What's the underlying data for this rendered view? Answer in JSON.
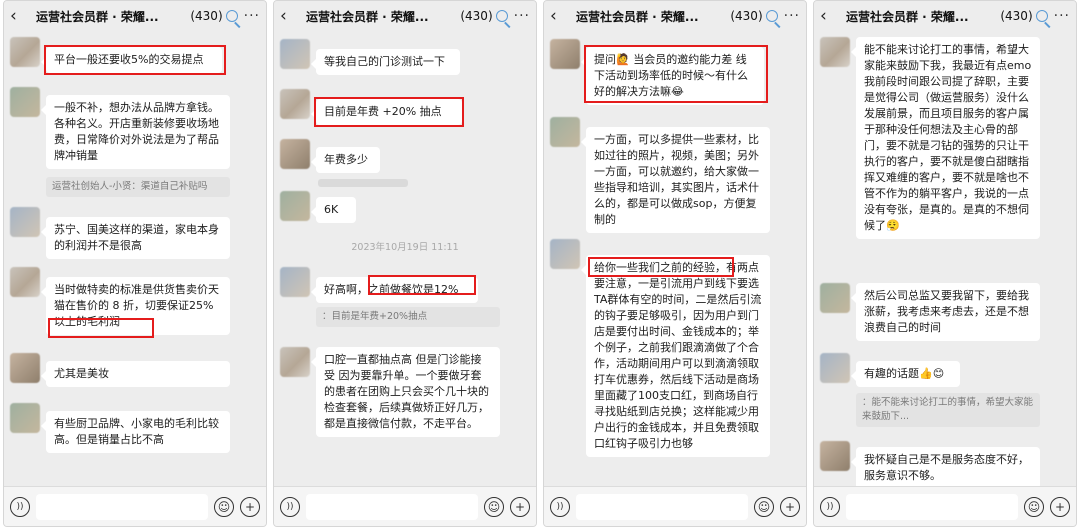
{
  "chat_header": {
    "back_icon": "chevron-left-icon",
    "title": "运营社会员群 · 荣耀...",
    "count": "(430)",
    "more": "···"
  },
  "panels": [
    {
      "messages": [
        "平台一般还要收5%的交易提点",
        "一般不补，想办法从品牌方拿钱。各种名义。开店重新装修要收场地费，日常降价对外说法是为了帮品牌冲销量",
        "苏宁、国美这样的渠道，家电本身的利润并不是很高",
        "当时做特卖的标准是供货售卖价天猫在售价的 8 折，切要保证25%以上的毛利润",
        "尤其是美妆",
        "有些厨卫品牌、小家电的毛利比较高。但是销量占比不高"
      ],
      "quote": "运营社创始人-小贤：渠道自己补贴吗"
    },
    {
      "messages": [
        "等我自己的门诊测试一下",
        "目前是年费 +20% 抽点",
        "年费多少",
        "6K",
        "好高啊，之前做餐饮是12%",
        "口腔一直都抽点高 但是门诊能接受 因为要靠升单。一个要做牙套的患者在团购上只会买个几十块的检查套餐，后续真做矫正好几万，都是直接微信付款，不走平台。"
      ],
      "timestamp": "2023年10月19日 11:11",
      "quote": "：目前是年费+20%抽点"
    },
    {
      "messages": [
        "提问🙋 当会员的邀约能力差 线下活动到场率低的时候～有什么好的解决方法嘛😂",
        "一方面，可以多提供一些素材，比如过往的照片，视频，美图；另外一方面，可以就邀约，给大家做一些指导和培训，其实图片，话术什么的，都是可以做成sop，方便复制的",
        "给你一些我们之前的经验，有两点要注意，一是引流用户到线下要选TA群体有空的时间，二是然后引流的钩子要足够吸引，因为用户到门店是要付出时间、金钱成本的；举个例子，之前我们跟滴滴做了个合作，活动期间用户可以到滴滴领取打车优惠券，然后线下活动是商场里面藏了100支口红，到商场自行寻找贴纸到店兑换；这样能减少用户出行的金钱成本，并且免费领取口红钩子吸引力也够"
      ]
    },
    {
      "messages": [
        "能不能来讨论打工的事情，希望大家能来鼓励下我，我最近有点emo 我前段时间跟公司提了辞职，主要是觉得公司（做运营服务）没什么发展前景，而且项目服务的客户属于那种没任何想法及主心骨的部门，要不就是刁钻的强势的只让干执行的客户，要不就是傻白甜瞎指挥又难缠的客户，要不就是啥也不管不作为的躺平客户，我说的一点没有夸张，是真的。是真的不想伺候了😮‍💨",
        "然后公司总监又要我留下，要给我涨薪，我考虑来考虑去，还是不想浪费自己的时间",
        "有趣的话题👍😊",
        "我怀疑自己是不是服务态度不好，服务意识不够。"
      ],
      "quote": "：能不能来讨论打工的事情，希望大家能来鼓励下..."
    }
  ],
  "footer": {
    "voice_icon": "voice-icon",
    "emoji_icon": "emoji-icon",
    "plus_icon": "plus-icon"
  }
}
